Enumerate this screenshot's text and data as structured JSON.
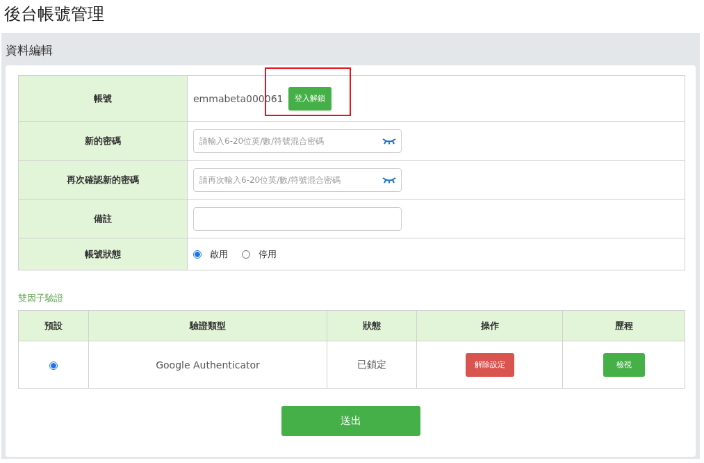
{
  "page_title": "後台帳號管理",
  "panel_title": "資料編輯",
  "form": {
    "rows": [
      {
        "kind": "account",
        "label": "帳號",
        "value": "emmabeta000061",
        "button": {
          "label": "登入解鎖",
          "highlighted": true
        }
      },
      {
        "kind": "password",
        "label": "新的密碼",
        "placeholder": "請輸入6-20位英/數/符號混合密碼"
      },
      {
        "kind": "password",
        "label": "再次確認新的密碼",
        "placeholder": "請再次輸入6-20位英/數/符號混合密碼"
      },
      {
        "kind": "input",
        "label": "備註"
      },
      {
        "kind": "radio",
        "label": "帳號狀態",
        "options": [
          {
            "label": "啟用",
            "selected": true
          },
          {
            "label": "停用",
            "selected": false
          }
        ]
      }
    ]
  },
  "two_factor": {
    "title": "雙因子驗證",
    "columns": [
      "預設",
      "驗證類型",
      "狀態",
      "操作",
      "歷程"
    ],
    "rows": [
      {
        "default": {
          "selected": true
        },
        "type": "Google Authenticator",
        "status": "已鎖定",
        "action": "解除設定",
        "history": "檢視"
      }
    ]
  },
  "submit": "送出"
}
